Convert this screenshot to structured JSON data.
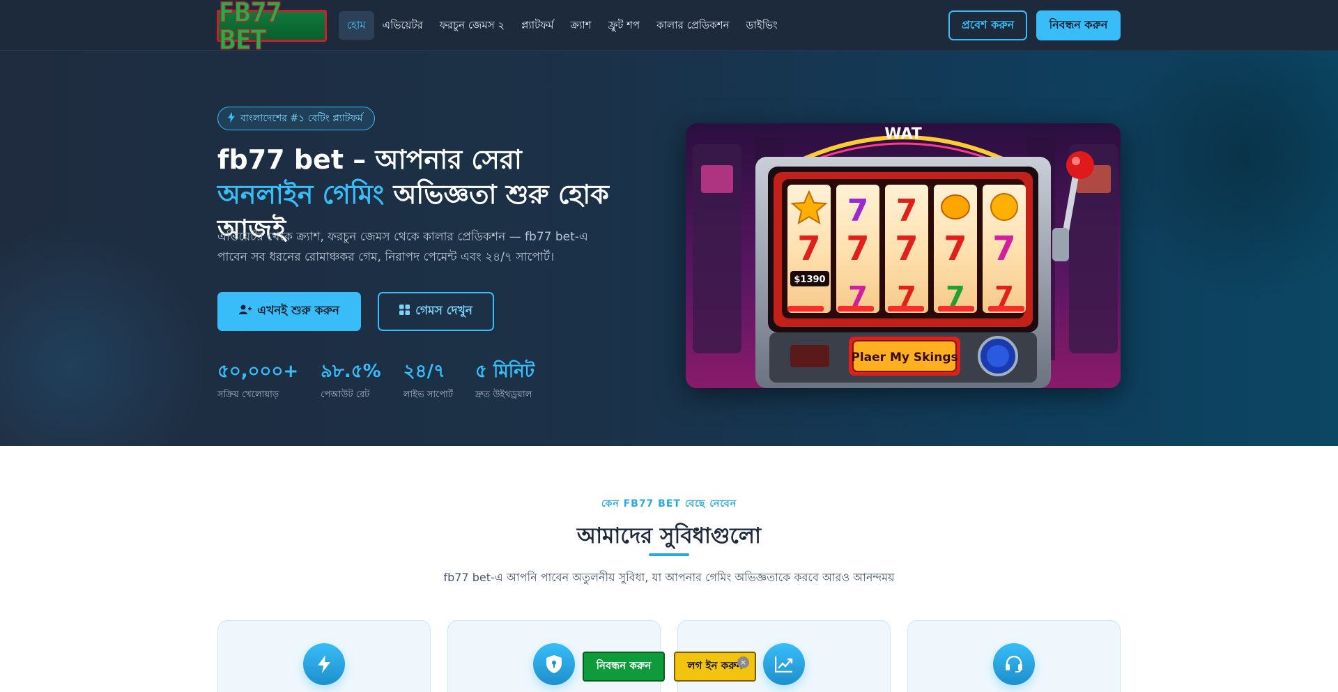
{
  "nav": {
    "logo_text": "FB77 BET",
    "items": [
      {
        "label": "হোম",
        "active": true
      },
      {
        "label": "এভিয়েটর"
      },
      {
        "label": "ফরচুন জেমস ২"
      },
      {
        "label": "প্ল্যাটফর্ম"
      },
      {
        "label": "ক্র্যাশ"
      },
      {
        "label": "ফ্রুট শপ"
      },
      {
        "label": "কালার প্রেডিকশন"
      },
      {
        "label": "ডাইভিং"
      }
    ],
    "login_label": "প্রবেশ করুন",
    "register_label": "নিবন্ধন করুন"
  },
  "hero": {
    "badge": "বাংলাদেশের #১ বেটিং প্ল্যাটফর্ম",
    "title_part1": "fb77 bet – আপনার সেরা ",
    "title_highlight": "অনলাইন গেমিং",
    "title_part2": " অভিজ্ঞতা শুরু হোক আজই",
    "subtitle": "এভিয়েটর থেকে ক্র্যাশ, ফরচুন জেমস থেকে কালার প্রেডিকশন — fb77 bet-এ পাবেন সব ধরনের রোমাঞ্চকর গেম, নিরাপদ পেমেন্ট এবং ২৪/৭ সাপোর্ট।",
    "cta_primary": "এখনই শুরু করুন",
    "cta_secondary": "গেমস দেখুন",
    "stats": [
      {
        "value": "৫০,০০০+",
        "label": "সক্রিয় খেলোয়াড়"
      },
      {
        "value": "৯৮.৫%",
        "label": "পেআউট রেট"
      },
      {
        "value": "২৪/৭",
        "label": "লাইভ সাপোর্ট"
      },
      {
        "value": "৫ মিনিট",
        "label": "দ্রুত উইথড্রয়াল"
      }
    ],
    "slot_image": {
      "top_sign": "WAT",
      "credit": "$1390",
      "button_text": "Plaer My Skings"
    }
  },
  "features": {
    "kicker": "কেন FB77 BET বেছে নেবেন",
    "title": "আমাদের সুবিধাগুলো",
    "subtitle": "fb77 bet-এ আপনি পাবেন অতুলনীয় সুবিধা, যা আপনার গেমিং অভিজ্ঞতাকে করবে আরও আনন্দময়",
    "cards": [
      {
        "icon": "lightning-icon"
      },
      {
        "icon": "shield-icon"
      },
      {
        "icon": "chart-up-icon"
      },
      {
        "icon": "headset-icon"
      }
    ]
  },
  "floating": {
    "register_label": "নিবন্ধন করুন",
    "login_label": "লগ ইন করুন",
    "close_glyph": "×"
  },
  "colors": {
    "accent": "#38bdf8",
    "nav_bg": "#1d2a3c",
    "float_register": "#0f9a3c",
    "float_login": "#f2c40f"
  }
}
